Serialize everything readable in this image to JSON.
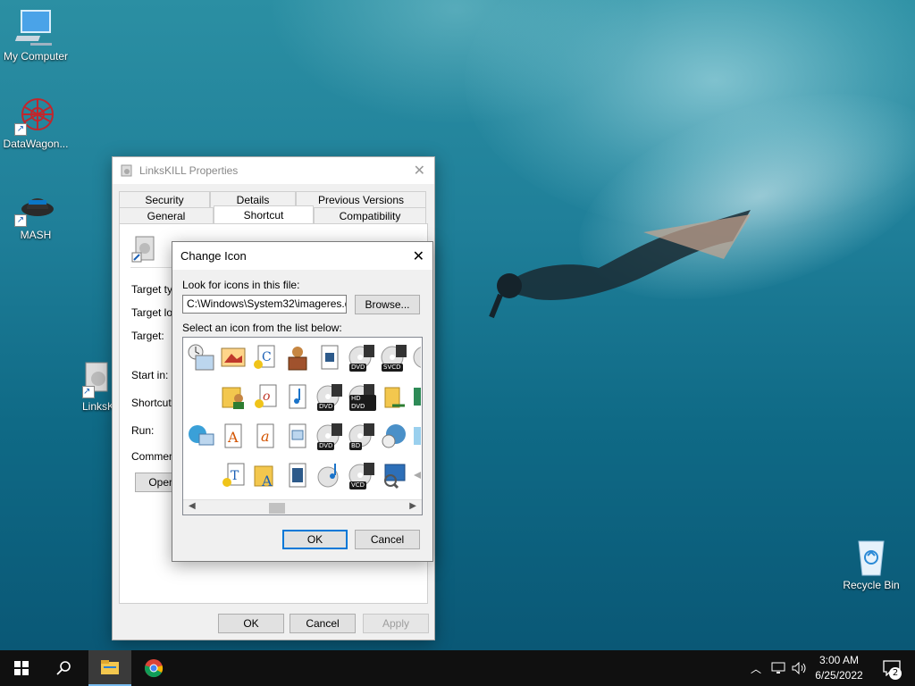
{
  "desktop": {
    "icons": [
      {
        "label": "My Computer"
      },
      {
        "label": "DataWagon..."
      },
      {
        "label": "MASH"
      },
      {
        "label": "LinksKI"
      },
      {
        "label": "Recycle Bin"
      }
    ]
  },
  "properties": {
    "title": "LinksKILL Properties",
    "tabs_back": [
      "Security",
      "Details",
      "Previous Versions"
    ],
    "tabs_front": [
      "General",
      "Shortcut",
      "Compatibility"
    ],
    "active_tab": "Shortcut",
    "fields": [
      "Target typ",
      "Target loc",
      "Target:",
      "Start in:",
      "Shortcut k",
      "Run:",
      "Comment:"
    ],
    "open_button": "Open",
    "ok": "OK",
    "cancel": "Cancel",
    "apply": "Apply"
  },
  "change_icon": {
    "title": "Change Icon",
    "look_label": "Look for icons in this file:",
    "path_value": "C:\\Windows\\System32\\imageres.dll",
    "browse": "Browse...",
    "select_label": "Select an icon from the list below:",
    "badges": [
      "DVD",
      "SVCD",
      "DVD",
      "HD DVD",
      "DVD",
      "BD",
      "VCD"
    ],
    "ok": "OK",
    "cancel": "Cancel"
  },
  "taskbar": {
    "time": "3:00 AM",
    "date": "6/25/2022",
    "notification_count": "2",
    "icons": [
      "windows-start-icon",
      "search-icon",
      "file-explorer-icon",
      "chrome-icon",
      "chevron-up-icon",
      "network-icon",
      "volume-icon",
      "action-center-icon"
    ]
  },
  "colors": {
    "accent": "#0078d7",
    "taskbar": "#101010",
    "desktop_water": "#1f7f99"
  }
}
